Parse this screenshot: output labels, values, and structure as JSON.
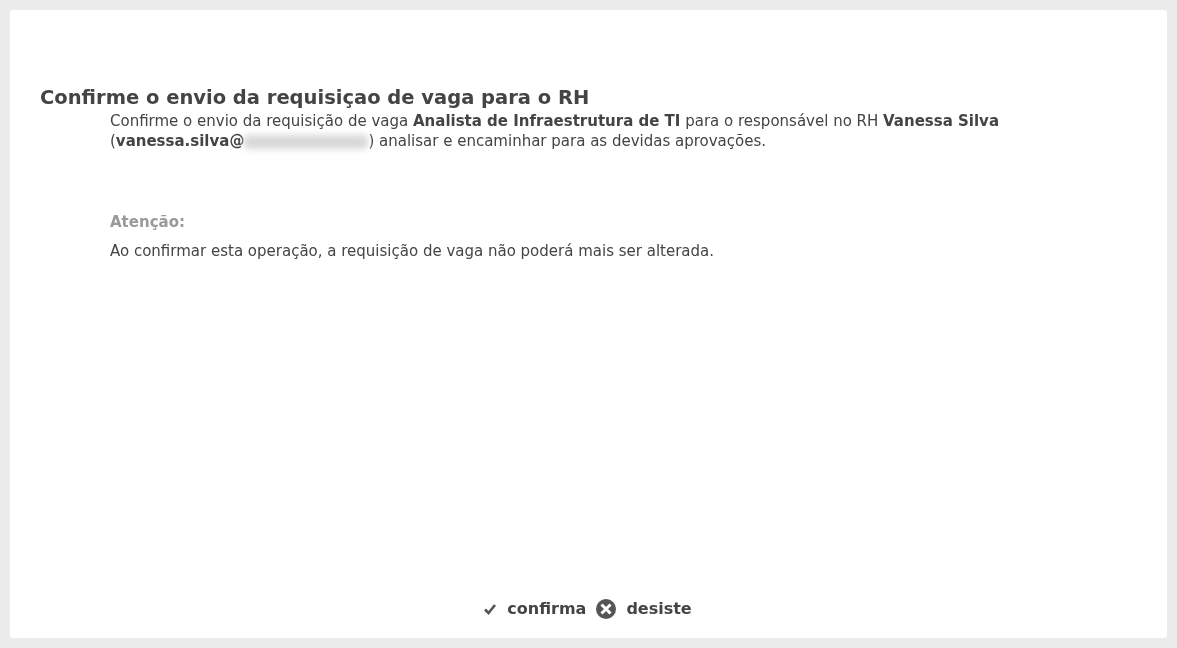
{
  "dialog": {
    "title": "Confirme o envio da requisiçao de vaga para o RH",
    "message": {
      "before": "Confirme o envio da requisição de vaga **Analista de Infraestrutura de TI** para o responsável no RH **Vanessa Silva** (**vanessa.silva@**",
      "after": ") analisar e encaminhar para as devidas aprovações."
    },
    "warning": {
      "heading": "Atenção:",
      "text": "Ao confirmar esta operação, a requisição de vaga não poderá mais ser alterada."
    },
    "buttons": [
      {
        "kind": "confirm",
        "label": "confirma"
      },
      {
        "kind": "cancel",
        "label": "desiste"
      }
    ]
  }
}
